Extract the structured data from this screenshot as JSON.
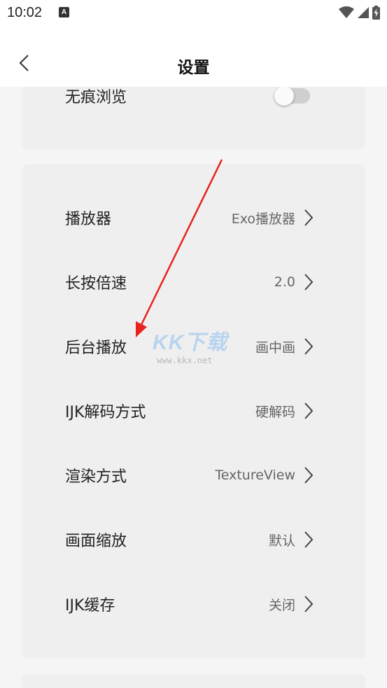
{
  "status_bar": {
    "time": "10:02",
    "app_icon_letter": "A",
    "icons": [
      "wifi-icon",
      "signal-icon",
      "battery-charging-icon"
    ]
  },
  "header": {
    "title": "设置",
    "back_icon": "chevron-left-icon"
  },
  "privacy_card": {
    "incognito": {
      "label": "无痕浏览",
      "enabled": false
    }
  },
  "player_settings": [
    {
      "key": "player",
      "label": "播放器",
      "value": "Exo播放器"
    },
    {
      "key": "long-press-speed",
      "label": "长按倍速",
      "value": "2.0"
    },
    {
      "key": "background-play",
      "label": "后台播放",
      "value": "画中画"
    },
    {
      "key": "ijk-decode",
      "label": "IJK解码方式",
      "value": "硬解码"
    },
    {
      "key": "render-mode",
      "label": "渲染方式",
      "value": "TextureView"
    },
    {
      "key": "screen-scale",
      "label": "画面缩放",
      "value": "默认"
    },
    {
      "key": "ijk-cache",
      "label": "IJK缓存",
      "value": "关闭"
    }
  ],
  "watermark": {
    "logo": "KK下载",
    "url": "www.kkx.net"
  },
  "colors": {
    "annotation_arrow": "#e8231e",
    "card_bg": "#efefef",
    "page_bg": "#f5f5f5"
  }
}
